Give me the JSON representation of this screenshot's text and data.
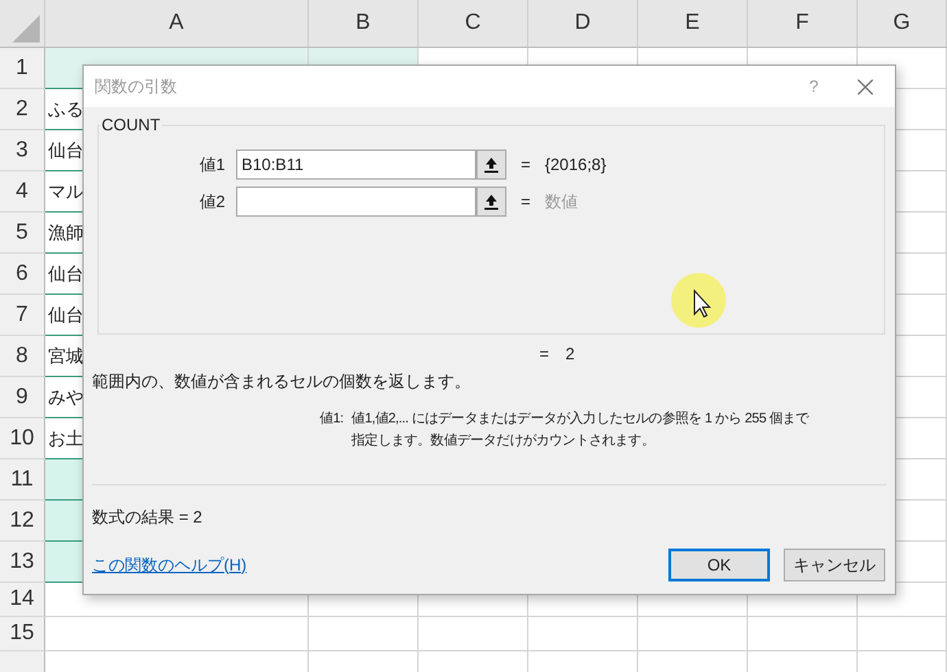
{
  "sheet": {
    "columns": [
      "A",
      "B",
      "C",
      "D",
      "E",
      "F",
      "G"
    ],
    "rows": [
      {
        "number": "1",
        "kind": "header",
        "cells": []
      },
      {
        "number": "2",
        "kind": "data",
        "cells": [
          "ふる"
        ]
      },
      {
        "number": "3",
        "kind": "data",
        "cells": [
          "仙台"
        ]
      },
      {
        "number": "4",
        "kind": "data",
        "cells": [
          "マル"
        ]
      },
      {
        "number": "5",
        "kind": "data",
        "cells": [
          "漁師"
        ]
      },
      {
        "number": "6",
        "kind": "data",
        "cells": [
          "仙台"
        ]
      },
      {
        "number": "7",
        "kind": "data",
        "cells": [
          "仙台"
        ]
      },
      {
        "number": "8",
        "kind": "data",
        "cells": [
          "宮城"
        ]
      },
      {
        "number": "9",
        "kind": "data",
        "cells": [
          "みや"
        ]
      },
      {
        "number": "10",
        "kind": "data",
        "cells": [
          "お土"
        ]
      },
      {
        "number": "11",
        "kind": "shaded",
        "cells": []
      },
      {
        "number": "12",
        "kind": "shaded",
        "cells": []
      },
      {
        "number": "13",
        "kind": "shaded",
        "cells": []
      },
      {
        "number": "14",
        "kind": "plain",
        "cells": []
      },
      {
        "number": "15",
        "kind": "plain",
        "cells": []
      },
      {
        "kind": "plain",
        "cells": []
      }
    ]
  },
  "dialog": {
    "title": "関数の引数",
    "help": "?",
    "function": "COUNT",
    "arguments": [
      {
        "label": "値1",
        "value": "B10:B11",
        "equals": "=",
        "result": "{2016;8}",
        "dimmed": false
      },
      {
        "label": "値2",
        "equals": "=",
        "result": "数値",
        "dimmed": true
      }
    ],
    "formula_value": {
      "equals": "=",
      "value": "2"
    },
    "description": "範囲内の、数値が含まれるセルの個数を返します。",
    "argument_help": {
      "label": "値1:",
      "lines": [
        "値1,値2,... にはデータまたはデータが入力したセルの参照を 1 から 255 個まで",
        "指定します。数値データだけがカウントされます。"
      ]
    },
    "formula_result": "数式の結果 =  2",
    "help_link": "この関数のヘルプ(H)",
    "buttons": [
      {
        "label": "OK",
        "default": true
      },
      {
        "label": "キャンセル",
        "default": false
      }
    ]
  }
}
